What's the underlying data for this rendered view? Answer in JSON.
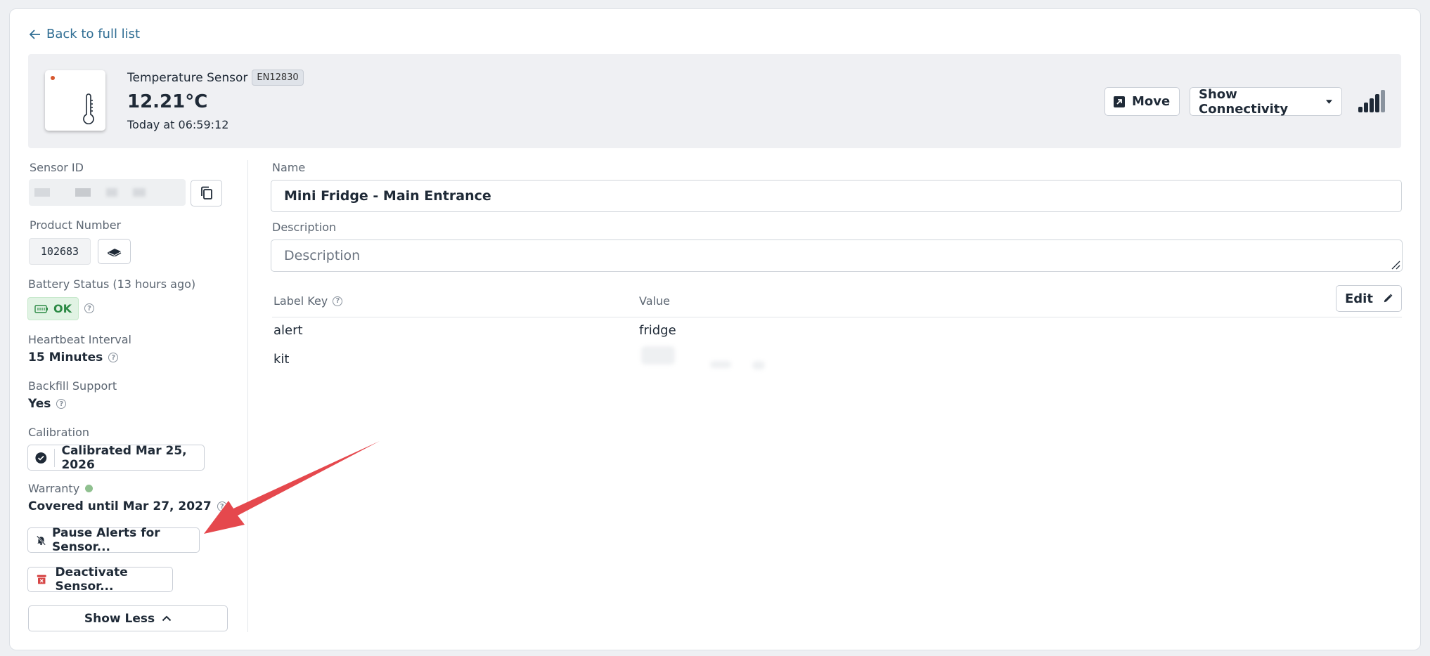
{
  "nav": {
    "back_label": "Back to full list"
  },
  "header": {
    "sensor_type": "Temperature Sensor",
    "sensor_code": "EN12830",
    "temperature": "12.21°C",
    "timestamp": "Today at 06:59:12",
    "move_label": "Move",
    "connectivity_label": "Show Connectivity"
  },
  "sidebar": {
    "sensor_id_label": "Sensor ID",
    "product_number_label": "Product Number",
    "product_number": "102683",
    "battery_label": "Battery Status (13 hours ago)",
    "battery_status": "OK",
    "heartbeat_label": "Heartbeat Interval",
    "heartbeat_value": "15 Minutes",
    "backfill_label": "Backfill Support",
    "backfill_value": "Yes",
    "calibration_label": "Calibration",
    "calibration_value": "Calibrated Mar 25, 2026",
    "warranty_label": "Warranty",
    "warranty_value": "Covered until Mar 27, 2027",
    "pause_alerts_label": "Pause Alerts for Sensor...",
    "deactivate_label": "Deactivate Sensor...",
    "show_less_label": "Show Less"
  },
  "main": {
    "name_label": "Name",
    "name_value": "Mini Fridge - Main Entrance",
    "description_label": "Description",
    "description_placeholder": "Description",
    "labels_table": {
      "key_header": "Label Key",
      "value_header": "Value",
      "edit_label": "Edit",
      "rows": [
        {
          "key": "alert",
          "value": "fridge"
        },
        {
          "key": "kit",
          "value": ""
        }
      ]
    }
  },
  "colors": {
    "accent": "#2f6d93",
    "ok_green": "#2c8a45",
    "annotation_red": "#e5484d",
    "warranty_dot": "#8fc08f"
  }
}
